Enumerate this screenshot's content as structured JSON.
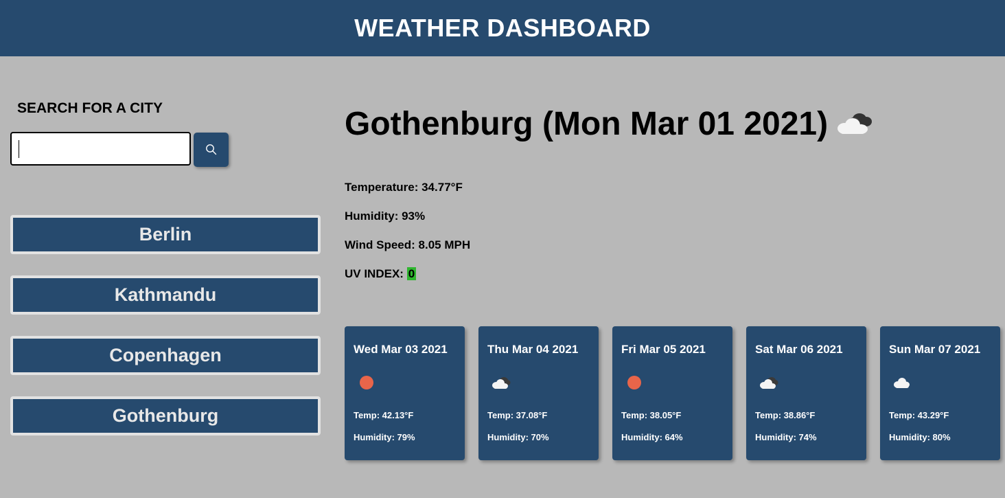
{
  "header": {
    "title": "WEATHER DASHBOARD"
  },
  "search": {
    "heading": "SEARCH FOR A CITY",
    "value": "",
    "placeholder": ""
  },
  "history": [
    "Berlin",
    "Kathmandu",
    "Copenhagen",
    "Gothenburg"
  ],
  "current": {
    "title": "Gothenburg (Mon Mar 01 2021)",
    "icon": "cloudy-icon",
    "temperature_label": "Temperature: 34.77°F",
    "humidity_label": "Humidity: 93%",
    "wind_label": "Wind Speed: 8.05 MPH",
    "uv_label": "UV INDEX:",
    "uv_value": "0",
    "uv_color": "#2fb62f"
  },
  "forecast": [
    {
      "date": "Wed Mar 03 2021",
      "icon": "sun-icon",
      "temp": "Temp: 42.13°F",
      "humidity": "Humidity: 79%"
    },
    {
      "date": "Thu Mar 04 2021",
      "icon": "partly-cloudy-icon",
      "temp": "Temp: 37.08°F",
      "humidity": "Humidity: 70%"
    },
    {
      "date": "Fri Mar 05 2021",
      "icon": "sun-icon",
      "temp": "Temp: 38.05°F",
      "humidity": "Humidity: 64%"
    },
    {
      "date": "Sat Mar 06 2021",
      "icon": "partly-cloudy-icon",
      "temp": "Temp: 38.86°F",
      "humidity": "Humidity: 74%"
    },
    {
      "date": "Sun Mar 07 2021",
      "icon": "cloud-icon",
      "temp": "Temp: 43.29°F",
      "humidity": "Humidity: 80%"
    }
  ],
  "colors": {
    "brand": "#264a6e",
    "background": "#b8b8b8",
    "sun": "#e8654a"
  }
}
